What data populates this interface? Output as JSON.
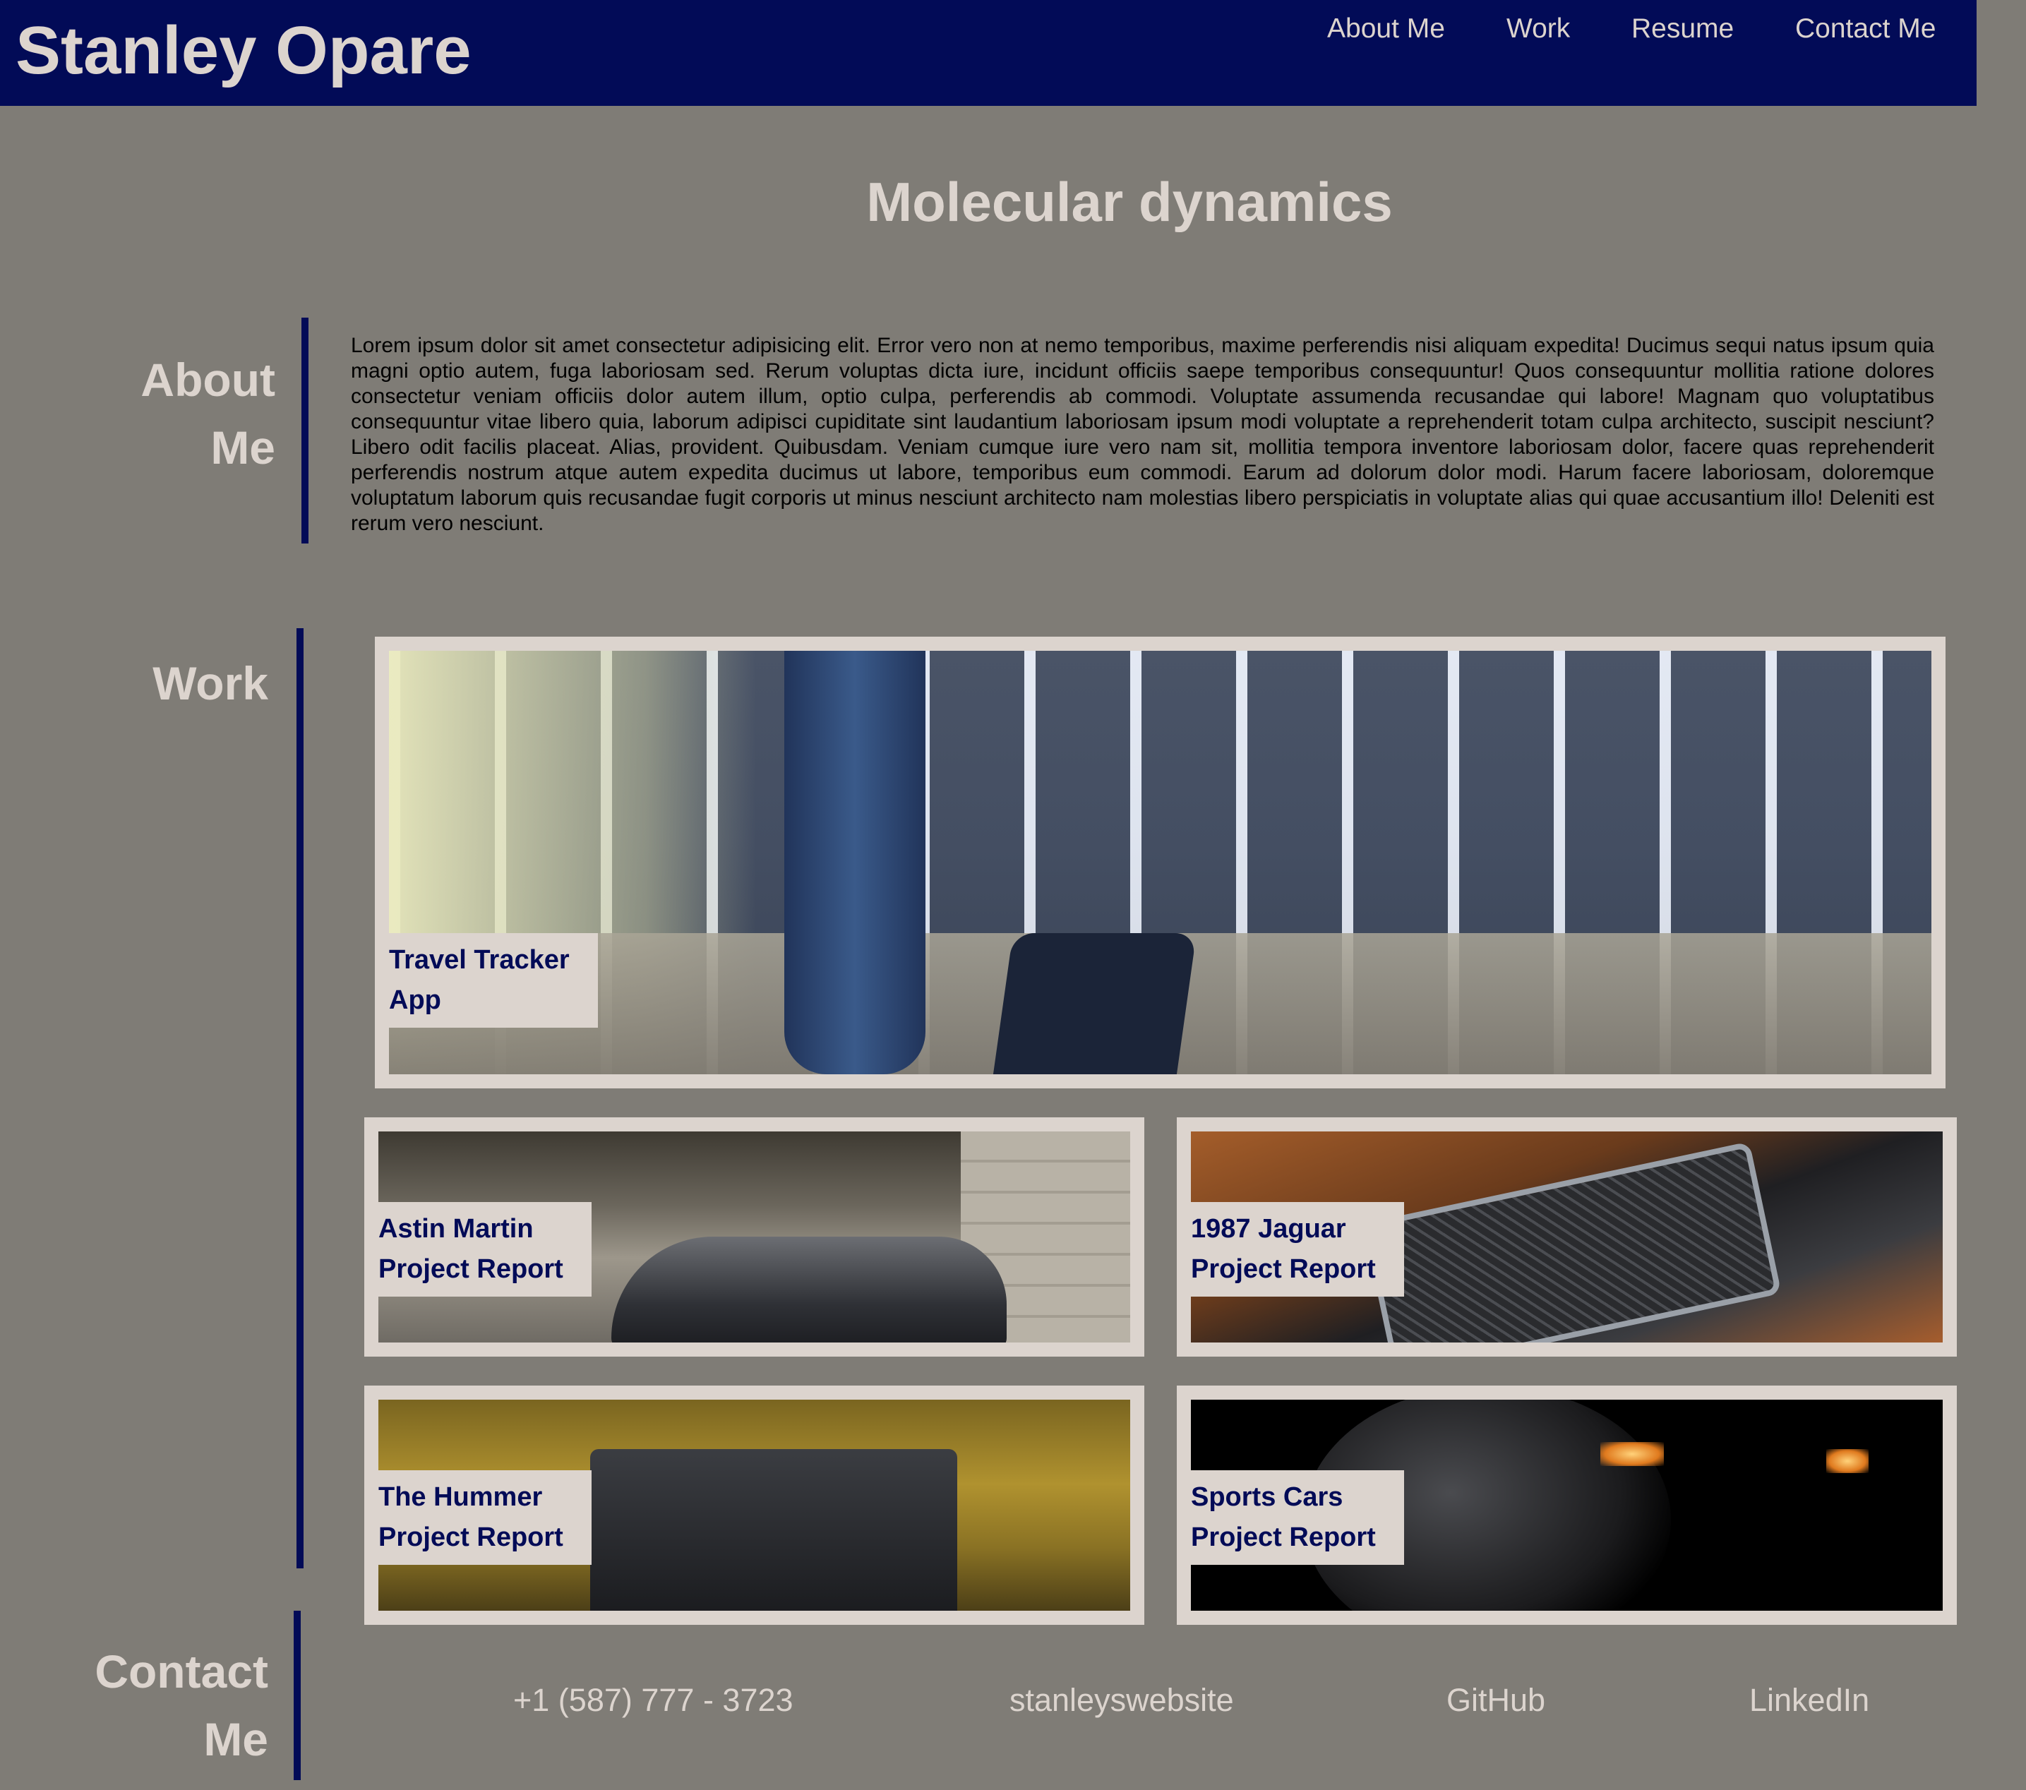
{
  "header": {
    "brand": "Stanley Opare",
    "nav": [
      {
        "label": "About Me"
      },
      {
        "label": "Work"
      },
      {
        "label": "Resume"
      },
      {
        "label": "Contact Me"
      }
    ]
  },
  "page_title": "Molecular dynamics",
  "about": {
    "heading": "About Me",
    "body": "Lorem ipsum dolor sit amet consectetur adipisicing elit. Error vero non at nemo temporibus, maxime perferendis nisi aliquam expedita! Ducimus sequi natus ipsum quia magni optio autem, fuga laboriosam sed. Rerum voluptas dicta iure, incidunt officiis saepe temporibus consequuntur! Quos consequuntur mollitia ratione dolores consectetur veniam officiis dolor autem illum, optio culpa, perferendis ab commodi. Voluptate assumenda recusandae qui labore! Magnam quo voluptatibus consequuntur vitae libero quia, laborum adipisci cupiditate sint laudantium laboriosam ipsum modi voluptate a reprehenderit totam culpa architecto, suscipit nesciunt? Libero odit facilis placeat. Alias, provident. Quibusdam. Veniam cumque iure vero nam sit, mollitia tempora inventore laboriosam dolor, facere quas reprehenderit perferendis nostrum atque autem expedita ducimus ut labore, temporibus eum commodi. Earum ad dolorum dolor modi. Harum facere laboriosam, doloremque voluptatum laborum quis recusandae fugit corporis ut minus nesciunt architecto nam molestias libero perspiciatis in voluptate alias qui quae accusantium illo! Deleniti est rerum vero nesciunt."
  },
  "work": {
    "heading": "Work",
    "projects": [
      {
        "title": "Travel Tracker\nApp"
      },
      {
        "title": "Astin Martin\nProject Report"
      },
      {
        "title": "1987 Jaguar\nProject Report"
      },
      {
        "title": "The Hummer\nProject Report"
      },
      {
        "title": "Sports Cars\nProject Report"
      }
    ]
  },
  "contact": {
    "heading": "Contact Me",
    "links": [
      {
        "label": "+1 (587) 777 - 3723"
      },
      {
        "label": "stanleyswebsite"
      },
      {
        "label": "GitHub"
      },
      {
        "label": "LinkedIn"
      }
    ]
  },
  "colors": {
    "background": "#7f7c76",
    "header": "#020b57",
    "accent_text": "#dcd4ce",
    "card_frame": "#dcd4ce"
  }
}
